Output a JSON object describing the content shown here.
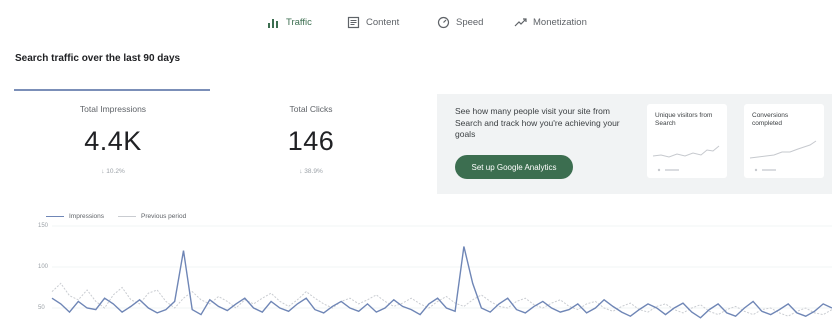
{
  "nav": {
    "tabs": [
      {
        "label": "Traffic",
        "icon": "bar-chart-icon",
        "active": true
      },
      {
        "label": "Content",
        "icon": "document-icon",
        "active": false
      },
      {
        "label": "Speed",
        "icon": "speedometer-icon",
        "active": false
      },
      {
        "label": "Monetization",
        "icon": "trending-icon",
        "active": false
      }
    ]
  },
  "section_title": "Search traffic over the last 90 days",
  "metrics": {
    "impressions": {
      "label": "Total Impressions",
      "value": "4.4K",
      "change": "↓ 10.2%"
    },
    "clicks": {
      "label": "Total Clicks",
      "value": "146",
      "change": "↓ 38.9%"
    }
  },
  "analytics_promo": {
    "text": "See how many people visit your site from Search and track how you're achieving your goals",
    "button_label": "Set up Google Analytics",
    "cards": [
      {
        "title": "Unique visitors from Search"
      },
      {
        "title": "Conversions completed"
      }
    ]
  },
  "chart": {
    "legend": {
      "current": "Impressions",
      "previous": "Previous period"
    },
    "y_ticks": [
      "150",
      "100",
      "50"
    ]
  },
  "colors": {
    "accent_green": "#3c6e50",
    "impressions_line": "#6f86b6",
    "previous_line": "#c9ccd1",
    "panel_bg": "#f1f3f4"
  },
  "chart_data": {
    "type": "line",
    "title": "",
    "xlabel": "",
    "ylabel": "",
    "ylim": [
      0,
      150
    ],
    "series": [
      {
        "name": "Impressions",
        "values": [
          62,
          55,
          45,
          58,
          50,
          48,
          62,
          55,
          45,
          52,
          60,
          50,
          44,
          48,
          58,
          120,
          48,
          42,
          60,
          52,
          47,
          55,
          62,
          50,
          45,
          58,
          50,
          46,
          55,
          62,
          48,
          44,
          52,
          58,
          50,
          46,
          55,
          45,
          50,
          60,
          52,
          48,
          42,
          55,
          62,
          50,
          46,
          125,
          80,
          50,
          45,
          55,
          62,
          48,
          44,
          52,
          58,
          50,
          45,
          48,
          55,
          44,
          50,
          60,
          52,
          45,
          40,
          48,
          55,
          50,
          42,
          50,
          56,
          45,
          38,
          48,
          55,
          44,
          40,
          50,
          58,
          46,
          42,
          48,
          55,
          44,
          40,
          46,
          55,
          50
        ]
      },
      {
        "name": "Previous period",
        "values": [
          70,
          80,
          65,
          60,
          72,
          58,
          50,
          66,
          75,
          60,
          55,
          68,
          72,
          58,
          50,
          62,
          70,
          60,
          55,
          64,
          58,
          50,
          60,
          55,
          62,
          68,
          58,
          52,
          60,
          70,
          62,
          55,
          50,
          58,
          62,
          55,
          60,
          66,
          58,
          52,
          56,
          62,
          55,
          50,
          58,
          64,
          56,
          52,
          60,
          66,
          58,
          52,
          50,
          58,
          62,
          54,
          50,
          56,
          60,
          52,
          48,
          55,
          58,
          50,
          46,
          52,
          56,
          48,
          45,
          52,
          55,
          48,
          44,
          50,
          54,
          46,
          42,
          48,
          52,
          46,
          42,
          48,
          50,
          44,
          40,
          46,
          50,
          44,
          42,
          48
        ]
      }
    ]
  }
}
